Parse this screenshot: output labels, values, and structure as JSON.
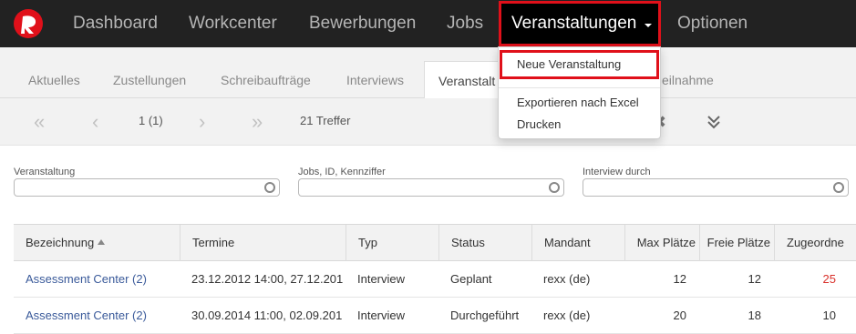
{
  "nav": {
    "items": [
      "Dashboard",
      "Workcenter",
      "Bewerbungen",
      "Jobs"
    ],
    "active": "Veranstaltungen",
    "after": "Optionen"
  },
  "dropdown": {
    "items": [
      "Neue Veranstaltung",
      "Exportieren nach Excel",
      "Drucken"
    ]
  },
  "subtabs": {
    "items": [
      "Aktuelles",
      "Zustellungen",
      "Schreibaufträge",
      "Interviews"
    ],
    "active": "Veranstalt",
    "trailing": "eilnahme"
  },
  "pager": {
    "page": "1 (1)",
    "hits": "21 Treffer"
  },
  "filters": {
    "veranstaltung_label": "Veranstaltung",
    "jobs_label": "Jobs, ID, Kennziffer",
    "interview_label": "Interview durch"
  },
  "table": {
    "headers": [
      "Bezeichnung",
      "Termine",
      "Typ",
      "Status",
      "Mandant",
      "Max Plätze",
      "Freie Plätze",
      "Zugeordne"
    ],
    "rows": [
      [
        "Assessment Center (2)",
        "23.12.2012 14:00, 27.12.201",
        "Interview",
        "Geplant",
        "rexx (de)",
        "12",
        "12",
        "25"
      ],
      [
        "Assessment Center (2)",
        "30.09.2014 11:00, 02.09.201",
        "Interview",
        "Durchgeführt",
        "rexx (de)",
        "20",
        "18",
        "10"
      ]
    ]
  },
  "colors": {
    "accent": "#e0101a",
    "link": "#3a5a9a",
    "navbar": "#222222"
  }
}
